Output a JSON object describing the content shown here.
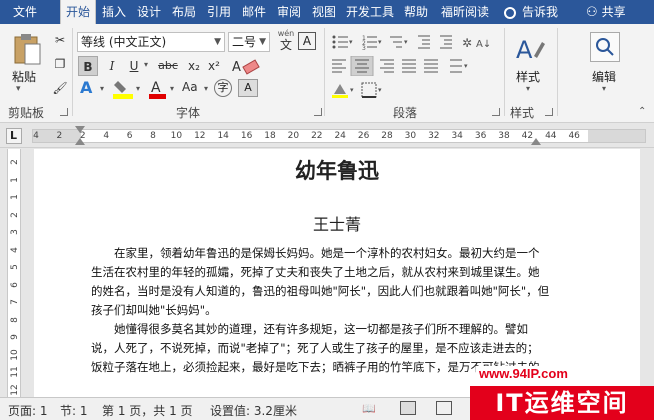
{
  "menu": {
    "tabs": [
      "文件",
      "开始",
      "插入",
      "设计",
      "布局",
      "引用",
      "邮件",
      "审阅",
      "视图",
      "开发工具",
      "帮助",
      "福昕阅读"
    ],
    "active": "开始",
    "search_label": "告诉我",
    "share_label": "共享"
  },
  "ribbon": {
    "clipboard": {
      "paste_label": "粘贴",
      "group_label": "剪贴板"
    },
    "font": {
      "font_name": "等线 (中文正文)",
      "font_size": "二号",
      "wen_top": "wén",
      "wen_char": "文",
      "a_box": "A",
      "bold": "B",
      "italic": "I",
      "underline": "U",
      "strike": "abc",
      "subscript": "x₂",
      "superscript": "x²",
      "aa_label": "Aa",
      "group_label": "字体"
    },
    "paragraph": {
      "group_label": "段落"
    },
    "styles": {
      "label": "样式",
      "group_label": "样式"
    },
    "editing": {
      "label": "编辑"
    }
  },
  "ruler": {
    "numbers": [
      "4",
      "2",
      "2",
      "4",
      "6",
      "8",
      "10",
      "12",
      "14",
      "16",
      "18",
      "20",
      "22",
      "24",
      "26",
      "28",
      "30",
      "32",
      "34",
      "36",
      "38",
      "42",
      "44",
      "46"
    ],
    "tab_icon": "L"
  },
  "vruler": {
    "numbers": [
      "2",
      "1",
      "1",
      "2",
      "3",
      "4",
      "5",
      "6",
      "7",
      "8",
      "9",
      "10",
      "11",
      "12",
      "13"
    ]
  },
  "document": {
    "title": "幼年鲁迅",
    "author": "王士菁",
    "paragraphs": [
      [
        "　　在家里，领着幼年鲁迅的是保姆长妈妈。她是一个淳朴的农村妇女。最初大约是一个",
        "生活在农村里的年轻的孤孀，死掉了丈夫和丧失了土地之后，就从农村来到城里谋生。她",
        "的姓名，当时是没有人知道的，鲁迅的祖母叫她\"阿长\"，因此人们也就跟着叫她\"阿长\"，但",
        "孩子们却叫她\"长妈妈\"。"
      ],
      [
        "　　她懂得很多莫名其妙的道理，还有许多规矩，这一切都是孩子们所不理解的。譬如",
        "说，人死了，不说死掉，而说\"老掉了\"；死了人或生了孩子的屋里，是不应该走进去的；",
        "饭粒子落在地上，必须捡起来，最好是吃下去；晒裤子用的竹竿底下，是万不可钻过去的……"
      ]
    ]
  },
  "status": {
    "page": "页面: 1",
    "section": "节: 1",
    "pages": "第 1 页，共 1 页",
    "setting": "设置值: 3.2厘米"
  },
  "watermark": {
    "url": "www.94IP.com",
    "logo": "IT运维空间"
  },
  "colors": {
    "brand": "#2b579a",
    "highlight": "#ffff00",
    "font_red": "#e00000",
    "watermark_red": "#e3001b"
  }
}
